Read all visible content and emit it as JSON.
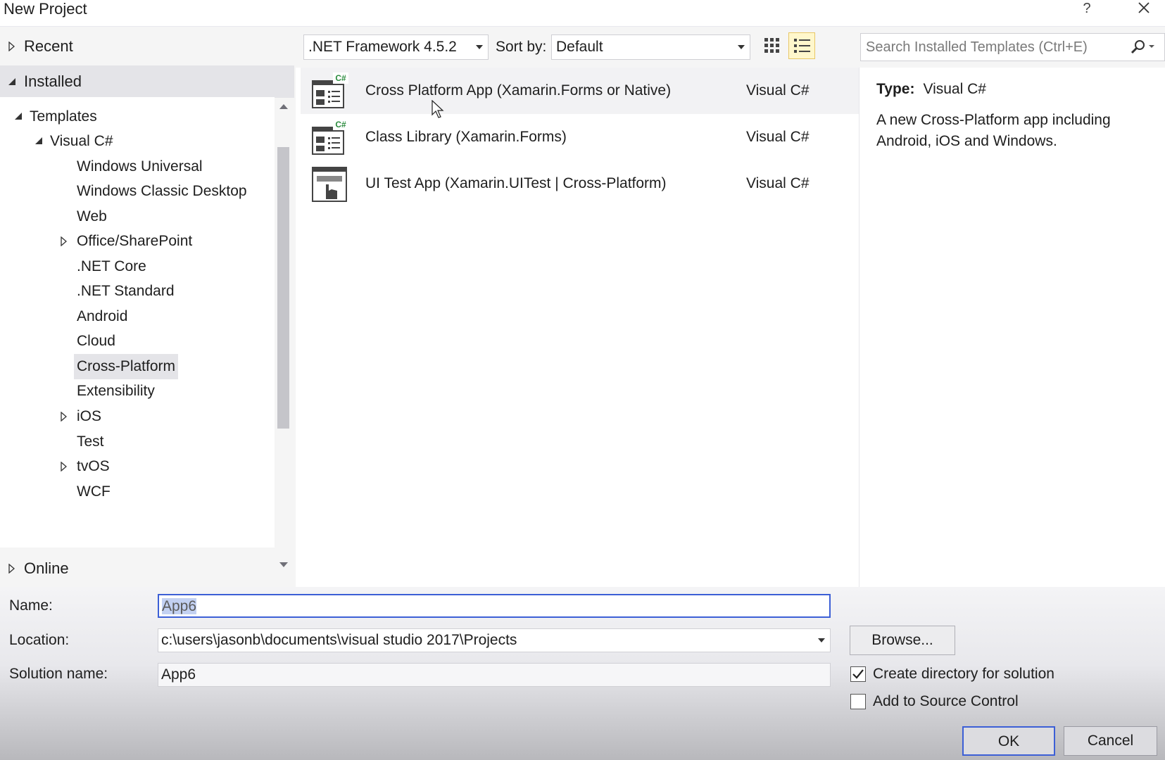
{
  "window": {
    "title": "New Project",
    "help_label": "?"
  },
  "left": {
    "recent": "Recent",
    "installed": "Installed",
    "online": "Online",
    "tree": [
      {
        "label": "Templates"
      },
      {
        "label": "Visual C#"
      },
      {
        "label": "Windows Universal"
      },
      {
        "label": "Windows Classic Desktop"
      },
      {
        "label": "Web"
      },
      {
        "label": "Office/SharePoint"
      },
      {
        "label": ".NET Core"
      },
      {
        "label": ".NET Standard"
      },
      {
        "label": "Android"
      },
      {
        "label": "Cloud"
      },
      {
        "label": "Cross-Platform"
      },
      {
        "label": "Extensibility"
      },
      {
        "label": "iOS"
      },
      {
        "label": "Test"
      },
      {
        "label": "tvOS"
      },
      {
        "label": "WCF"
      }
    ],
    "selected": "Cross-Platform"
  },
  "toolbar": {
    "framework": ".NET Framework 4.5.2",
    "sort_label": "Sort by:",
    "sort_value": "Default",
    "search_placeholder": "Search Installed Templates (Ctrl+E)"
  },
  "templates": [
    {
      "name": "Cross Platform App (Xamarin.Forms or Native)",
      "lang": "Visual C#",
      "badge": "C#"
    },
    {
      "name": "Class Library (Xamarin.Forms)",
      "lang": "Visual C#",
      "badge": "C#"
    },
    {
      "name": "UI Test App (Xamarin.UITest | Cross-Platform)",
      "lang": "Visual C#"
    }
  ],
  "details": {
    "type_label": "Type:",
    "type_value": "Visual C#",
    "description": "A new Cross-Platform app including Android, iOS and Windows."
  },
  "form": {
    "name_label": "Name:",
    "name_value": "App6",
    "location_label": "Location:",
    "location_value": "c:\\users\\jasonb\\documents\\visual studio 2017\\Projects",
    "solution_label": "Solution name:",
    "solution_value": "App6",
    "browse_label": "Browse...",
    "create_dir_label": "Create directory for solution",
    "create_dir_checked": true,
    "source_control_label": "Add to Source Control",
    "source_control_checked": false,
    "ok_label": "OK",
    "cancel_label": "Cancel"
  },
  "colors": {
    "accent": "#3c5fd6",
    "selection": "#e4e4e8",
    "active_view": "#fff7cc"
  }
}
